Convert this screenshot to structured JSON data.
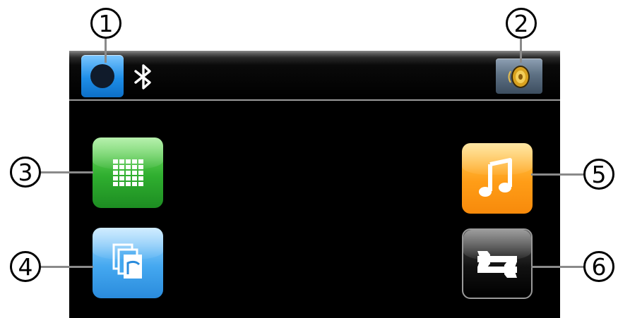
{
  "callouts": [
    "1",
    "2",
    "3",
    "4",
    "5",
    "6"
  ],
  "statusbar": {
    "bluetooth_button": {
      "icon": "bluetooth-icon",
      "color": "#1e8ee8"
    },
    "bluetooth_status": {
      "icon": "bluetooth-icon",
      "color": "#ffffff"
    },
    "speaker_button": {
      "icon": "speaker-icon",
      "color": "#5e7184"
    }
  },
  "apps": [
    {
      "id": "keypad",
      "icon": "keypad-icon",
      "color": "#2fae2f"
    },
    {
      "id": "files",
      "icon": "files-icon",
      "color": "#44a8f0"
    },
    {
      "id": "music",
      "icon": "music-note-icon",
      "color": "#ff9d17"
    },
    {
      "id": "settings",
      "icon": "wrench-icon",
      "color": "#111111"
    }
  ]
}
